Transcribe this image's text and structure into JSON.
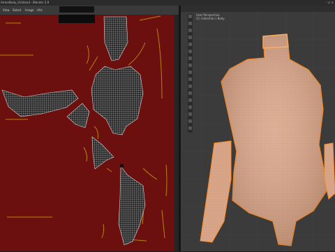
{
  "window": {
    "title": "ArmorBody_UV.blend - Blender 2.9",
    "controls": "– ☐ ✕"
  },
  "uv_editor": {
    "menus": [
      "View",
      "Select",
      "Image",
      "UVs"
    ],
    "image_name": "",
    "texture_color": "#6b0f0f",
    "mesh_color": "#cfcfcf",
    "seam_color": "#b8860b"
  },
  "viewport": {
    "info_lines": [
      "User Perspective",
      "(1) Collection | Body"
    ],
    "mesh_color": "#d9a588",
    "highlight_color": "#ff8a1f"
  },
  "icons": {
    "tools": [
      "cursor-icon",
      "move-icon",
      "rotate-icon",
      "scale-icon",
      "transform-icon",
      "annotate-icon",
      "measure-icon",
      "extrude-icon",
      "inset-icon",
      "bevel-icon",
      "loopcut-icon",
      "knife-icon",
      "polybuild-icon",
      "spin-icon",
      "smooth-icon",
      "shear-icon",
      "rip-icon"
    ]
  }
}
